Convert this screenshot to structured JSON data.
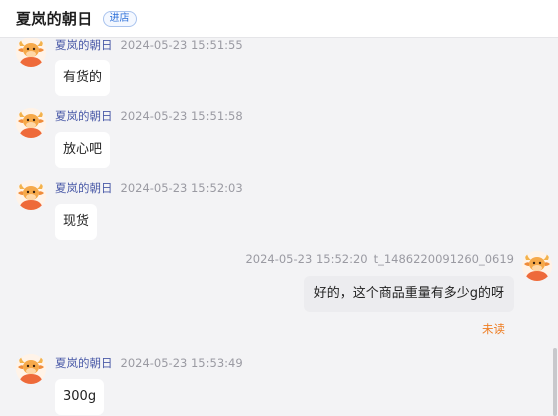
{
  "header": {
    "title": "夏岚的朝日",
    "shop_badge": "进店"
  },
  "messages": [
    {
      "nickname": "夏岚的朝日",
      "time": "2024-05-23 15:51:55",
      "text": "有货的"
    },
    {
      "nickname": "夏岚的朝日",
      "time": "2024-05-23 15:51:58",
      "text": "放心吧"
    },
    {
      "nickname": "夏岚的朝日",
      "time": "2024-05-23 15:52:03",
      "text": "现货"
    },
    {
      "nickname": "t_1486220091260_0619",
      "time": "2024-05-23 15:52:20",
      "text": "好的，这个商品重量有多少g的呀",
      "status": "未读"
    },
    {
      "nickname": "夏岚的朝日",
      "time": "2024-05-23 15:53:49",
      "text": "300g"
    }
  ],
  "icons": {
    "avatar": "cartoon-bull-avatar-icon"
  },
  "colors": {
    "unread": "#ee7d22",
    "nickname": "#4a5aa8",
    "background": "#f3f3f5"
  }
}
